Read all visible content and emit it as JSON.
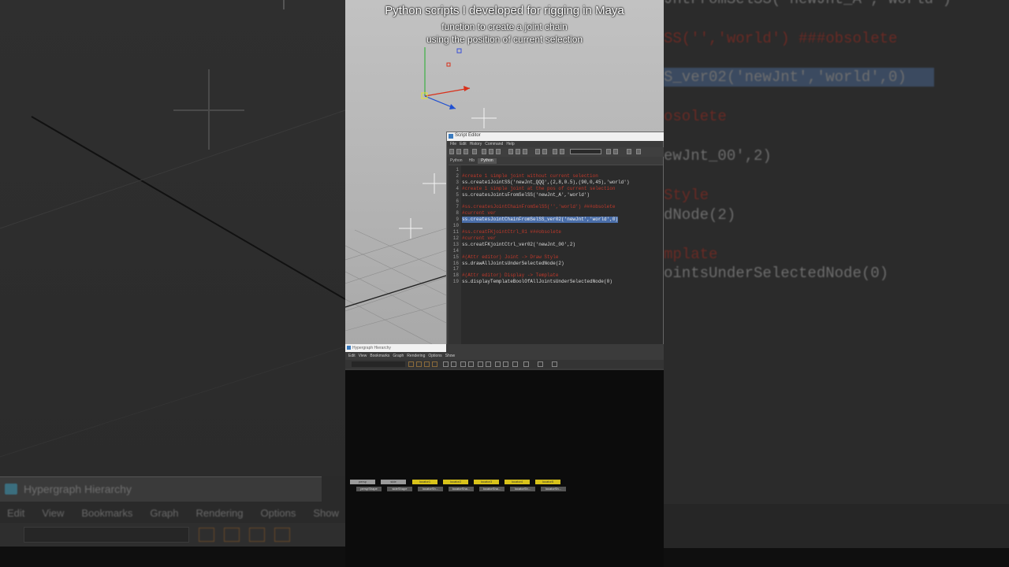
{
  "video_caption": {
    "line1": "Python scripts I developed for rigging in Maya",
    "line2": "function to create a joint chain",
    "line3": "using the position of current selection"
  },
  "left_background": {
    "panel_title": "Hypergraph Hierarchy",
    "menu": [
      "Edit",
      "View",
      "Bookmarks",
      "Graph",
      "Rendering",
      "Options",
      "Show"
    ]
  },
  "right_background": {
    "lines": [
      {
        "text": "JntFromSelSS('newJnt_A','world')",
        "style": "white"
      },
      {
        "text": "SS('','world') ###obsolete",
        "style": "red"
      },
      {
        "text": "S_ver02('newJnt','world',0)",
        "style": "white"
      },
      {
        "text": "osolete",
        "style": "red"
      },
      {
        "text": "ewJnt_00',2)",
        "style": "white"
      },
      {
        "text": "Style",
        "style": "red"
      },
      {
        "text": "dNode(2)",
        "style": "white"
      },
      {
        "text": "mplate",
        "style": "red"
      },
      {
        "text": "ointsUnderSelectedNode(0)",
        "style": "white"
      }
    ]
  },
  "script_editor": {
    "title": "Script Editor",
    "menu": [
      "File",
      "Edit",
      "History",
      "Command",
      "Help"
    ],
    "tabs": [
      "Python",
      "Hlb",
      "Python"
    ],
    "lines": [
      {
        "n": "1",
        "text": "",
        "type": "code"
      },
      {
        "n": "2",
        "text": "#create 1 simple joint without current selection",
        "type": "cmt"
      },
      {
        "n": "3",
        "text": "ss.create1JointSS('newJnt_QQQ',(2,8,0.5),(90,0,45),'world')",
        "type": "code"
      },
      {
        "n": "4",
        "text": "#create 1 simple joint at the pos of current selection",
        "type": "cmt"
      },
      {
        "n": "5",
        "text": "ss.createsJointsFromSelSS('newJnt_A','world')",
        "type": "code"
      },
      {
        "n": "6",
        "text": "",
        "type": "code"
      },
      {
        "n": "7",
        "text": "#ss.createsJointChainFromSelSS('','world') ###obsolete",
        "type": "cmt"
      },
      {
        "n": "8",
        "text": "#current ver",
        "type": "cmt"
      },
      {
        "n": "9",
        "text": "ss.createsJointChainFromSelSS_ver02('newJnt','world',0)",
        "type": "sel"
      },
      {
        "n": "10",
        "text": "",
        "type": "code"
      },
      {
        "n": "11",
        "text": "#ss.creatFKjointCtrl_01 ###obsolete",
        "type": "cmt"
      },
      {
        "n": "12",
        "text": "#current ver",
        "type": "cmt"
      },
      {
        "n": "13",
        "text": "ss.creatFKjointCtrl_ver02('newJnt_00',2)",
        "type": "code"
      },
      {
        "n": "14",
        "text": "",
        "type": "code"
      },
      {
        "n": "15",
        "text": "#(Attr editor) Joint -> Draw Style",
        "type": "cmt"
      },
      {
        "n": "16",
        "text": "ss.drawAllJointsUnderSelectedNode(2)",
        "type": "code"
      },
      {
        "n": "17",
        "text": "",
        "type": "code"
      },
      {
        "n": "18",
        "text": "#(Attr editor) Display -> Template",
        "type": "cmt"
      },
      {
        "n": "19",
        "text": "ss.displayTemplateBoolOfAllJointsUnderSelectedNode(0)",
        "type": "code"
      }
    ]
  },
  "hypergraph": {
    "title": "Hypergraph Hierarchy",
    "menu": [
      "Edit",
      "View",
      "Bookmarks",
      "Graph",
      "Rendering",
      "Options",
      "Show"
    ],
    "nodes_row1": [
      {
        "label": "persp",
        "color": "gray"
      },
      {
        "label": "side",
        "color": "gray"
      },
      {
        "label": "locator1",
        "color": "yellow"
      },
      {
        "label": "locator2",
        "color": "yellow"
      },
      {
        "label": "locator3",
        "color": "yellow"
      },
      {
        "label": "locator4",
        "color": "yellow"
      },
      {
        "label": "locator5",
        "color": "yellow"
      }
    ],
    "nodes_row2": [
      {
        "label": "perspShape",
        "color": "dark"
      },
      {
        "label": "sideShape",
        "color": "dark"
      },
      {
        "label": "locatorSh...",
        "color": "dark"
      },
      {
        "label": "locatorSha...",
        "color": "dark"
      },
      {
        "label": "locatorSha...",
        "color": "dark"
      },
      {
        "label": "locatorSh...",
        "color": "dark"
      },
      {
        "label": "locatorSh...",
        "color": "dark"
      }
    ]
  },
  "colors": {
    "comment": "#c0392b",
    "selection": "#4a6ea9",
    "locator": "#d8c21a"
  }
}
